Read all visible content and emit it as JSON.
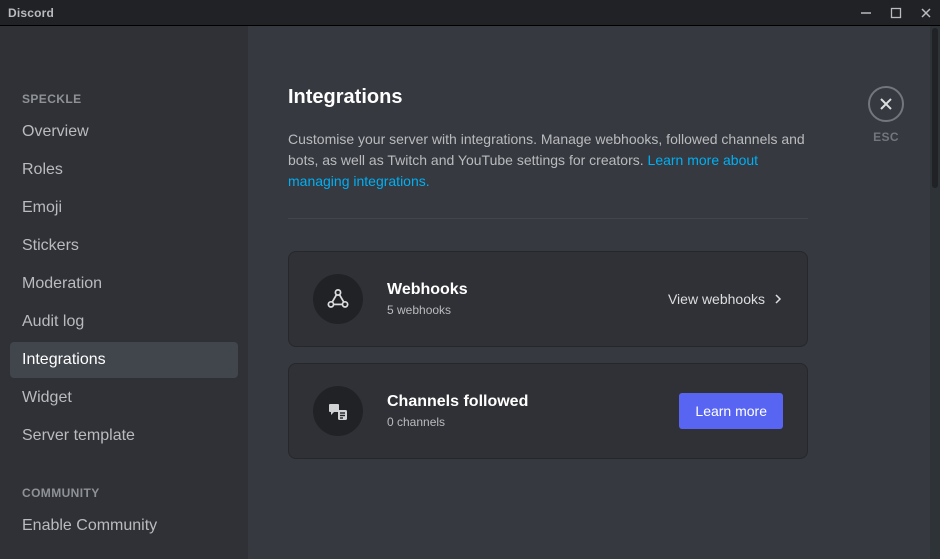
{
  "titlebar": {
    "logo": "Discord"
  },
  "sidebar": {
    "section1_header": "SPECKLE",
    "items1": [
      {
        "label": "Overview"
      },
      {
        "label": "Roles"
      },
      {
        "label": "Emoji"
      },
      {
        "label": "Stickers"
      },
      {
        "label": "Moderation"
      },
      {
        "label": "Audit log"
      },
      {
        "label": "Integrations"
      },
      {
        "label": "Widget"
      },
      {
        "label": "Server template"
      }
    ],
    "section2_header": "COMMUNITY",
    "items2": [
      {
        "label": "Enable Community"
      }
    ]
  },
  "page": {
    "title": "Integrations",
    "description_pre": "Customise your server with integrations. Manage webhooks, followed channels and bots, as well as Twitch and YouTube settings for creators. ",
    "description_link": "Learn more about managing integrations."
  },
  "cards": {
    "webhooks": {
      "title": "Webhooks",
      "subtitle": "5 webhooks",
      "action": "View webhooks"
    },
    "channels": {
      "title": "Channels followed",
      "subtitle": "0 channels",
      "action": "Learn more"
    }
  },
  "close": {
    "esc": "ESC"
  }
}
